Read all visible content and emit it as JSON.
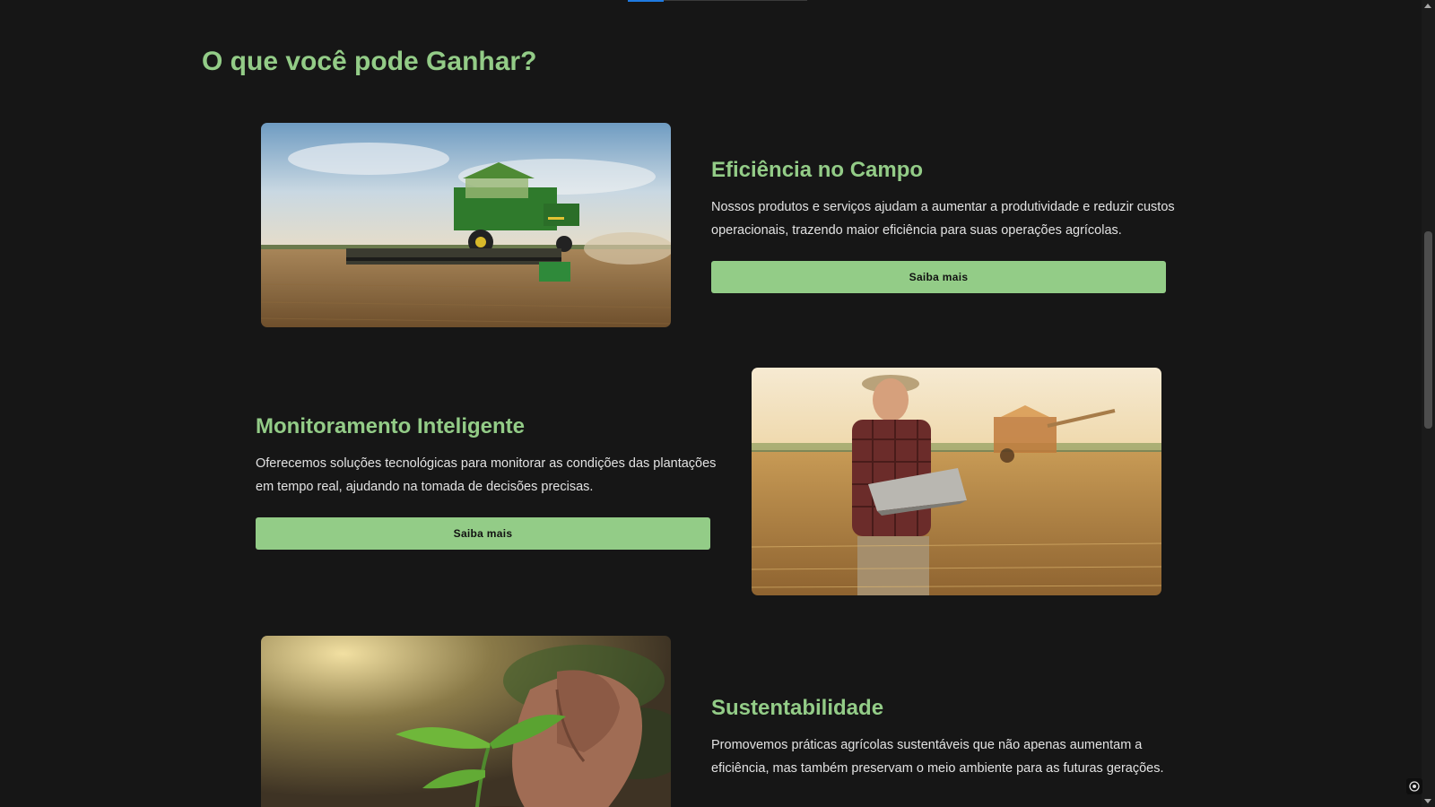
{
  "section": {
    "title": "O que você pode Ganhar?"
  },
  "features": [
    {
      "title": "Eficiência no Campo",
      "description": "Nossos produtos e serviços ajudam a aumentar a produtividade e reduzir custos operacionais, trazendo maior eficiência para suas operações agrícolas.",
      "button_label": "Saiba mais",
      "image": "combine-harvester-photo"
    },
    {
      "title": "Monitoramento Inteligente",
      "description": "Oferecemos soluções tecnológicas para monitorar as condições das plantações em tempo real, ajudando na tomada de decisões precisas.",
      "button_label": "Saiba mais",
      "image": "farmer-with-laptop-photo"
    },
    {
      "title": "Sustentabilidade",
      "description": "Promovemos práticas agrícolas sustentáveis que não apenas aumentam a eficiência, mas também preservam o meio ambiente para as futuras gerações.",
      "image": "seedling-in-hands-photo"
    }
  ],
  "colors": {
    "background": "#161616",
    "accent": "#93cc87",
    "text": "#e2e2e2",
    "button_text": "#111111"
  },
  "icons": {
    "corner": "target-icon"
  }
}
